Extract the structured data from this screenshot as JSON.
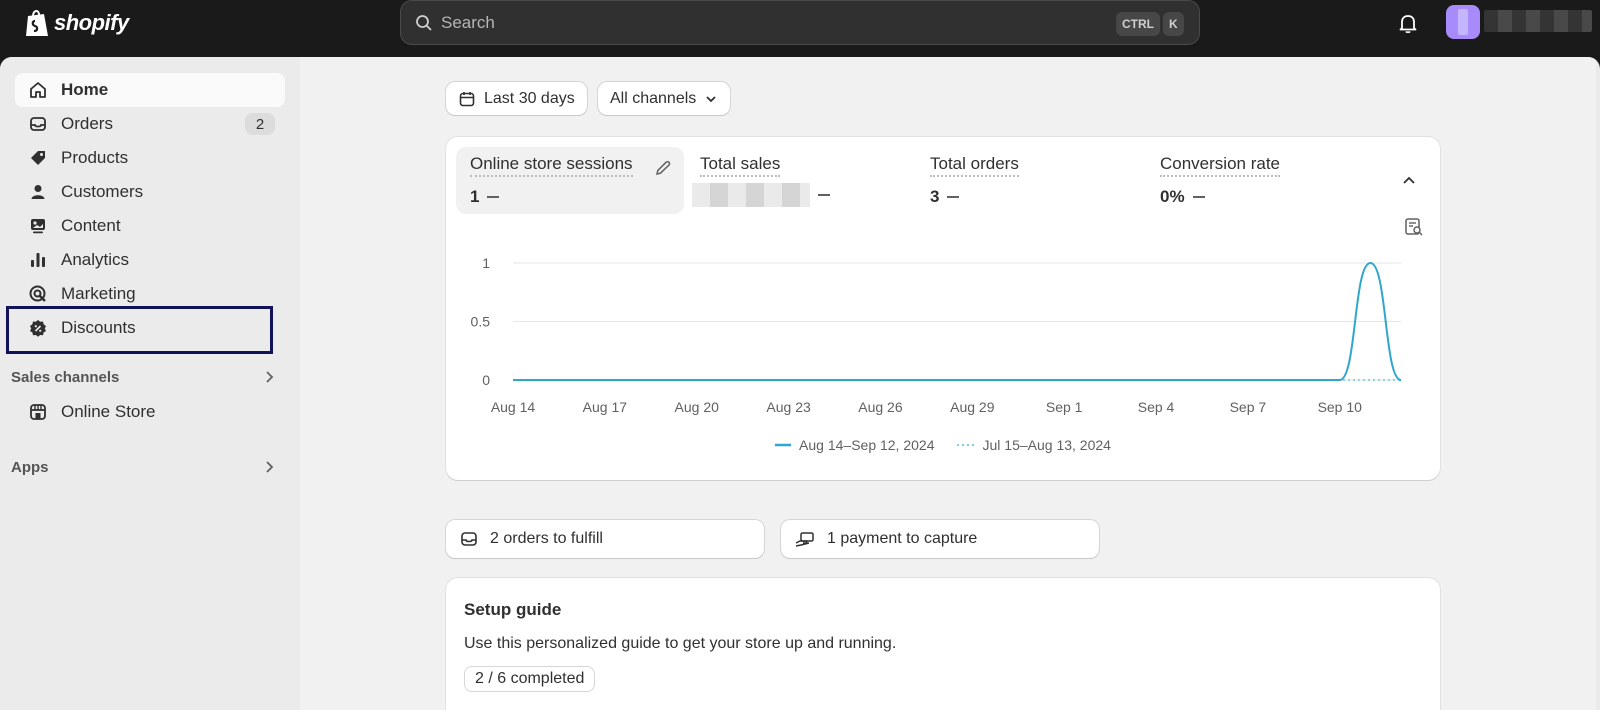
{
  "topbar": {
    "logo_text": "shopify",
    "search_placeholder": "Search",
    "shortcut_ctrl": "CTRL",
    "shortcut_key": "K"
  },
  "sidebar": {
    "items": [
      {
        "label": "Home",
        "icon": "home-icon",
        "active": true
      },
      {
        "label": "Orders",
        "icon": "inbox-icon",
        "badge": "2"
      },
      {
        "label": "Products",
        "icon": "tag-icon"
      },
      {
        "label": "Customers",
        "icon": "person-icon"
      },
      {
        "label": "Content",
        "icon": "image-icon"
      },
      {
        "label": "Analytics",
        "icon": "bar-chart-icon"
      },
      {
        "label": "Marketing",
        "icon": "target-icon"
      },
      {
        "label": "Discounts",
        "icon": "discount-icon"
      }
    ],
    "sales_channels_label": "Sales channels",
    "online_store_label": "Online Store",
    "apps_label": "Apps"
  },
  "filters": {
    "date_label": "Last 30 days",
    "channel_label": "All channels"
  },
  "metrics": [
    {
      "label": "Online store sessions",
      "value": "1"
    },
    {
      "label": "Total sales",
      "value": ""
    },
    {
      "label": "Total orders",
      "value": "3"
    },
    {
      "label": "Conversion rate",
      "value": "0%"
    }
  ],
  "chart_data": {
    "type": "line",
    "x_ticks": [
      "Aug 14",
      "Aug 17",
      "Aug 20",
      "Aug 23",
      "Aug 26",
      "Aug 29",
      "Sep 1",
      "Sep 4",
      "Sep 7",
      "Sep 10"
    ],
    "y_ticks": [
      "1",
      "0.5",
      "0"
    ],
    "ylim": [
      0,
      1
    ],
    "x": [
      "Aug 14",
      "Aug 15",
      "Aug 16",
      "Aug 17",
      "Aug 18",
      "Aug 19",
      "Aug 20",
      "Aug 21",
      "Aug 22",
      "Aug 23",
      "Aug 24",
      "Aug 25",
      "Aug 26",
      "Aug 27",
      "Aug 28",
      "Aug 29",
      "Aug 30",
      "Aug 31",
      "Sep 1",
      "Sep 2",
      "Sep 3",
      "Sep 4",
      "Sep 5",
      "Sep 6",
      "Sep 7",
      "Sep 8",
      "Sep 9",
      "Sep 10",
      "Sep 11",
      "Sep 12"
    ],
    "series": [
      {
        "name": "Aug 14–Sep 12, 2024",
        "color": "#2fa6cc",
        "style": "solid",
        "values": [
          0,
          0,
          0,
          0,
          0,
          0,
          0,
          0,
          0,
          0,
          0,
          0,
          0,
          0,
          0,
          0,
          0,
          0,
          0,
          0,
          0,
          0,
          0,
          0,
          0,
          0,
          0,
          0,
          1,
          0
        ]
      },
      {
        "name": "Jul 15–Aug 13, 2024",
        "color": "#7fcfe3",
        "style": "dotted",
        "values": [
          0,
          0,
          0,
          0,
          0,
          0,
          0,
          0,
          0,
          0,
          0,
          0,
          0,
          0,
          0,
          0,
          0,
          0,
          0,
          0,
          0,
          0,
          0,
          0,
          0,
          0,
          0,
          0,
          0,
          0
        ]
      }
    ],
    "grid": true,
    "legend": "bottom"
  },
  "tasks": {
    "fulfill": "2 orders to fulfill",
    "capture": "1 payment to capture"
  },
  "setup": {
    "title": "Setup guide",
    "description": "Use this personalized guide to get your store up and running.",
    "progress": "2 / 6 completed"
  }
}
